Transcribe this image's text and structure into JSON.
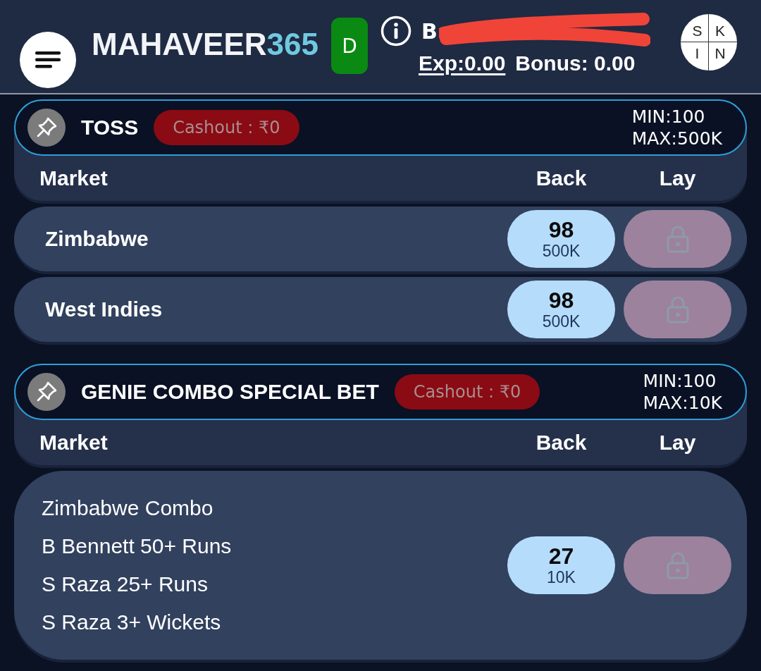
{
  "header": {
    "logo": {
      "main": "MAHAVEER",
      "accent": "365"
    },
    "badge": "D",
    "balance": "B",
    "exposure": "Exp:0.00",
    "bonus": "Bonus: 0.00",
    "skin": [
      "S",
      "K",
      "I",
      "N"
    ]
  },
  "markets": [
    {
      "title": "TOSS",
      "cashout": "Cashout : ₹0",
      "min": "MIN:100",
      "max": "MAX:500K",
      "columns": [
        "Market",
        "Back",
        "Lay"
      ],
      "runners": [
        {
          "kind": "team",
          "lines": [
            "Zimbabwe"
          ],
          "back": {
            "odds": "98",
            "size": "500K"
          },
          "lay": {
            "locked": true
          }
        },
        {
          "kind": "team",
          "lines": [
            "West Indies"
          ],
          "back": {
            "odds": "98",
            "size": "500K"
          },
          "lay": {
            "locked": true
          }
        }
      ]
    },
    {
      "title": "GENIE COMBO SPECIAL BET",
      "cashout": "Cashout : ₹0",
      "min": "MIN:100",
      "max": "MAX:10K",
      "columns": [
        "Market",
        "Back",
        "Lay"
      ],
      "runners": [
        {
          "kind": "combo",
          "lines": [
            "Zimbabwe Combo",
            "B Bennett 50+ Runs",
            "S Raza 25+ Runs",
            "S Raza 3+ Wickets"
          ],
          "back": {
            "odds": "27",
            "size": "10K"
          },
          "lay": {
            "locked": true
          }
        }
      ]
    }
  ]
}
